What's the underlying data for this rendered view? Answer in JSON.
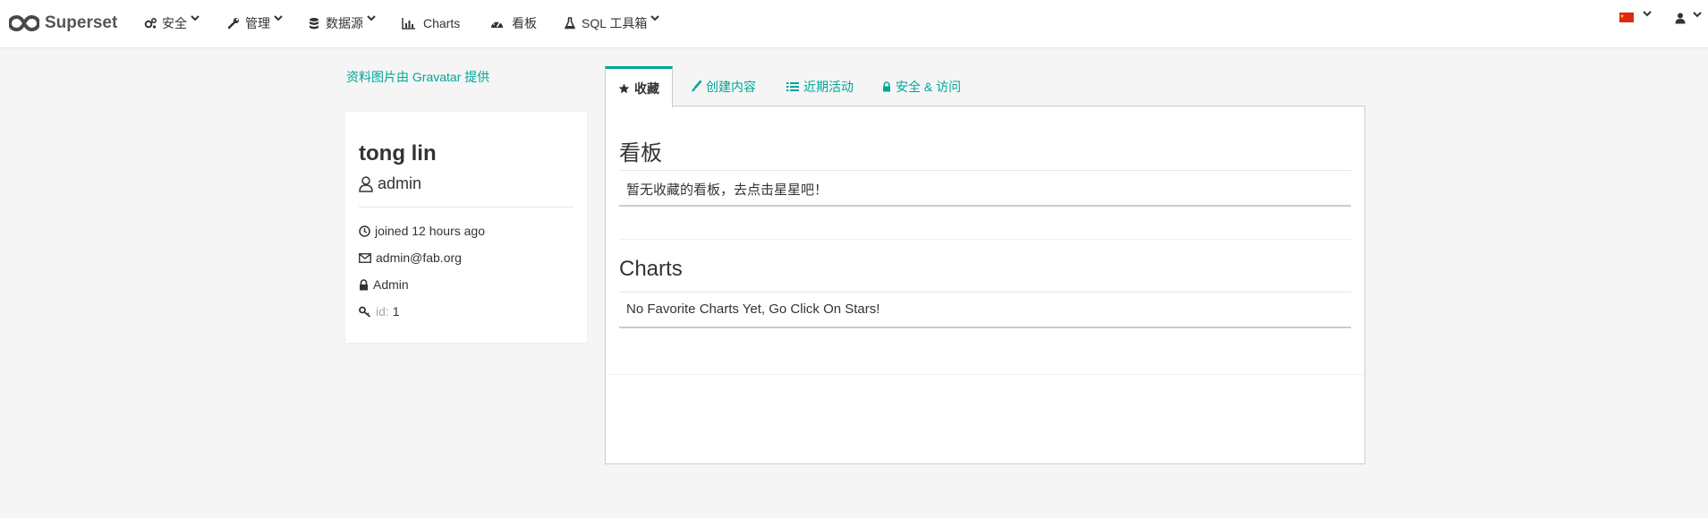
{
  "brand": {
    "name": "Superset"
  },
  "nav": {
    "security": "安全",
    "manage": "管理",
    "sources": "数据源",
    "charts": "Charts",
    "dashboards": "看板",
    "sql_lab": "SQL 工具箱"
  },
  "profile": {
    "gravatar_note": "资料图片由 Gravatar 提供",
    "name": "tong lin",
    "username": "admin",
    "joined": "joined 12 hours ago",
    "email": "admin@fab.org",
    "role": "Admin",
    "id_label": "id:",
    "id_value": "1"
  },
  "tabs": [
    {
      "label": "收藏",
      "icon": "star-icon"
    },
    {
      "label": "创建内容",
      "icon": "paint-brush-icon"
    },
    {
      "label": "近期活动",
      "icon": "list-icon"
    },
    {
      "label": "安全 & 访问",
      "icon": "lock-icon"
    }
  ],
  "favorites": {
    "dashboards_title": "看板",
    "dashboards_empty": "暂无收藏的看板，去点击星星吧！",
    "charts_title": "Charts",
    "charts_empty": "No Favorite Charts Yet, Go Click On Stars!"
  },
  "colors": {
    "accent": "#00a699",
    "background": "#f5f5f5"
  },
  "icons": {
    "language": "china-flag-icon",
    "user_menu": "user-icon"
  }
}
